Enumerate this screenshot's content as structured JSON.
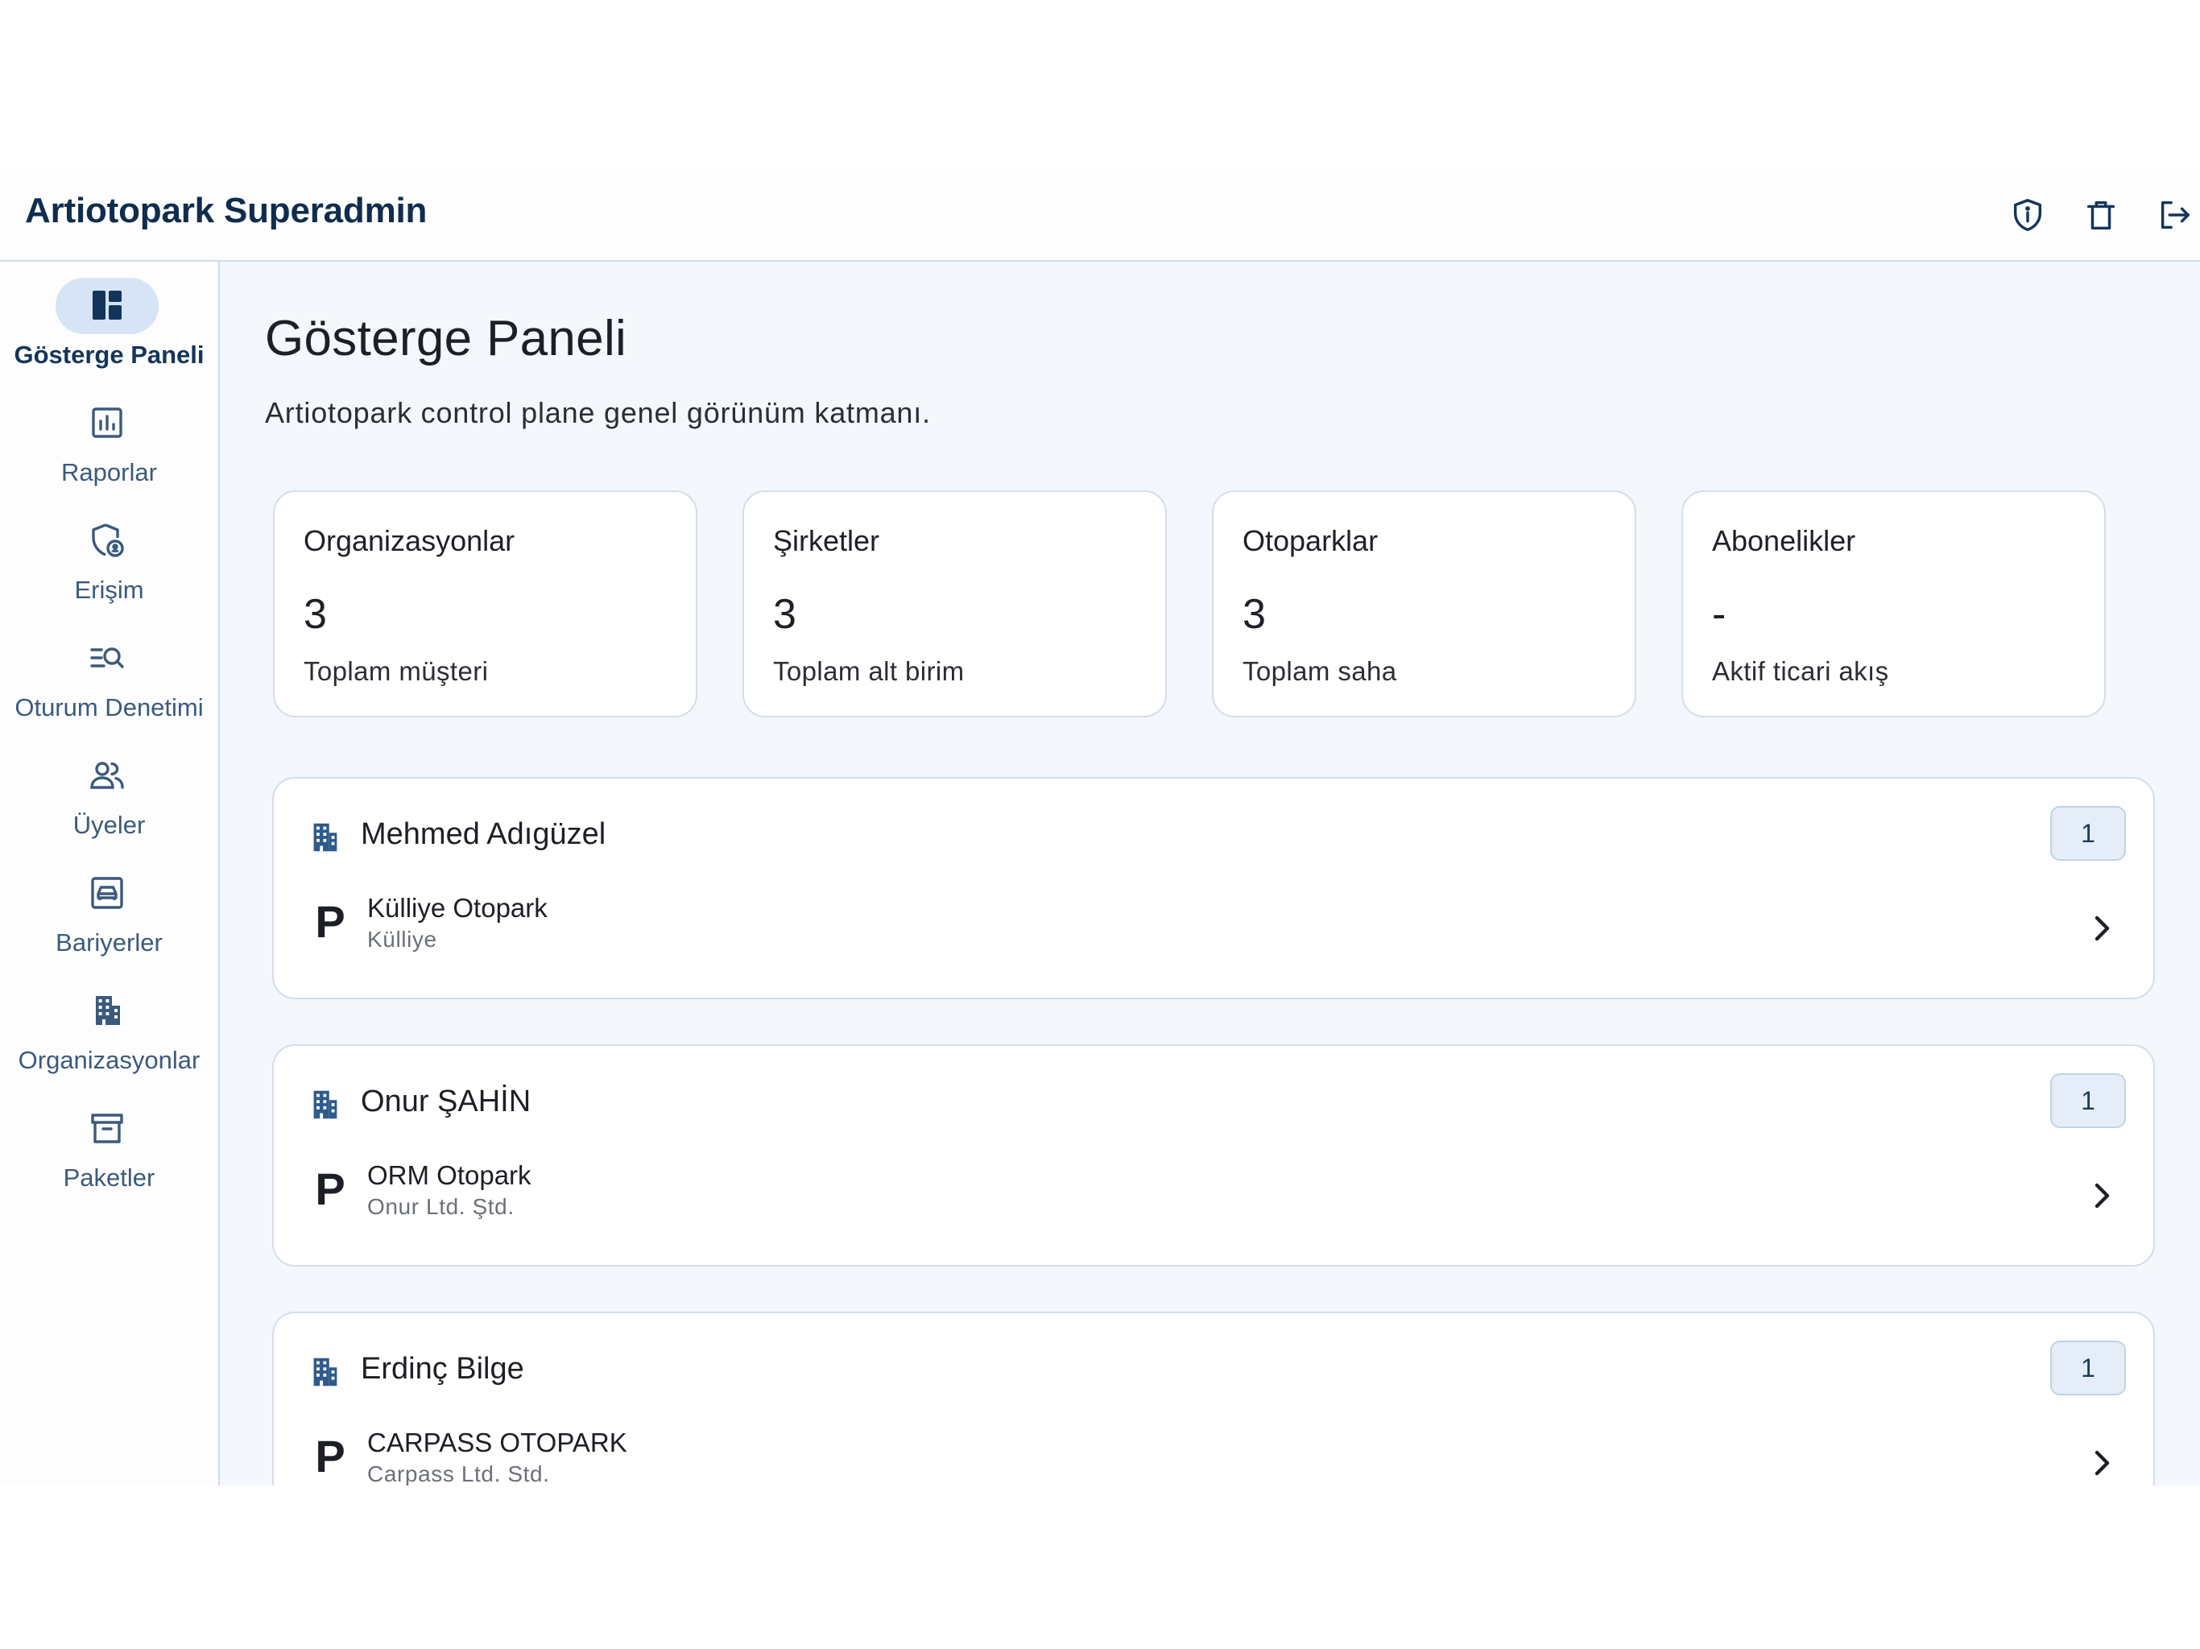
{
  "app": {
    "title": "Artiotopark Superadmin"
  },
  "topbar_actions": [
    {
      "name": "privacy-shield-icon",
      "tooltip": ""
    },
    {
      "name": "delete-icon",
      "tooltip": ""
    },
    {
      "name": "logout-icon",
      "tooltip": ""
    }
  ],
  "nav": {
    "items": [
      {
        "label": "Gösterge Paneli",
        "icon": "dashboard-icon",
        "active": true
      },
      {
        "label": "Raporlar",
        "icon": "bar-chart-icon",
        "active": false
      },
      {
        "label": "Erişim",
        "icon": "shield-lock-icon",
        "active": false
      },
      {
        "label": "Oturum Denetimi",
        "icon": "manage-search-icon",
        "active": false
      },
      {
        "label": "Üyeler",
        "icon": "group-icon",
        "active": false
      },
      {
        "label": "Bariyerler",
        "icon": "garage-car-icon",
        "active": false
      },
      {
        "label": "Organizasyonlar",
        "icon": "building-icon",
        "active": false
      },
      {
        "label": "Paketler",
        "icon": "archive-box-icon",
        "active": false
      }
    ]
  },
  "page": {
    "title": "Gösterge Paneli",
    "subtitle": "Artiotopark control plane genel görünüm katmanı."
  },
  "stats": [
    {
      "label": "Organizasyonlar",
      "value": "3",
      "caption": "Toplam müşteri"
    },
    {
      "label": "Şirketler",
      "value": "3",
      "caption": "Toplam alt birim"
    },
    {
      "label": "Otoparklar",
      "value": "3",
      "caption": "Toplam saha"
    },
    {
      "label": "Abonelikler",
      "value": "-",
      "caption": "Aktif ticari akış"
    }
  ],
  "organizations": [
    {
      "name": "Mehmed Adıgüzel",
      "count": "1",
      "lots": [
        {
          "icon": "P",
          "name": "Külliye Otopark",
          "company": "Külliye"
        }
      ]
    },
    {
      "name": "Onur ŞAHİN",
      "count": "1",
      "lots": [
        {
          "icon": "P",
          "name": "ORM Otopark",
          "company": "Onur Ltd. Ştd."
        }
      ]
    },
    {
      "name": "Erdinç Bilge",
      "count": "1",
      "lots": [
        {
          "icon": "P",
          "name": "CARPASS OTOPARK",
          "company": "Carpass Ltd. Std."
        }
      ]
    }
  ],
  "colors": {
    "primary": "#0f2d4d",
    "accent": "#2f5b8a",
    "surface": "#f4f7fb",
    "outline": "#d3deea",
    "active_pill": "#d6e4f6"
  }
}
